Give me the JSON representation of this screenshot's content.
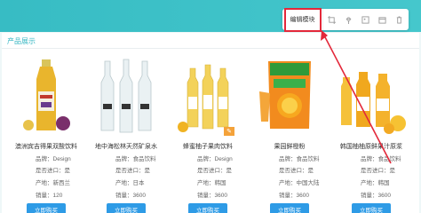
{
  "toolbar": {
    "edit_label": "编辑模块",
    "icons": [
      "crop-icon",
      "pin-icon",
      "layers-icon",
      "window-icon",
      "trash-icon"
    ],
    "highlight_color": "#e3283a"
  },
  "section": {
    "title": "产品展示"
  },
  "products": [
    {
      "name": "澳洲宾吉得果双酸饮料",
      "specs": [
        {
          "k": "品牌：",
          "v": "Design"
        },
        {
          "k": "是否进口：",
          "v": "是"
        },
        {
          "k": "产地：",
          "v": "新西兰"
        },
        {
          "k": "销量：",
          "v": "120"
        }
      ],
      "buy": "立即购买"
    },
    {
      "name": "地中海松林天然矿泉水",
      "specs": [
        {
          "k": "品牌：",
          "v": "食品饮料"
        },
        {
          "k": "是否进口：",
          "v": "是"
        },
        {
          "k": "产地：",
          "v": "日本"
        },
        {
          "k": "销量：",
          "v": "3600"
        }
      ],
      "buy": "立即购买"
    },
    {
      "name": "蜂蜜柚子果肉饮料",
      "specs": [
        {
          "k": "品牌：",
          "v": "Design"
        },
        {
          "k": "是否进口：",
          "v": "是"
        },
        {
          "k": "产地：",
          "v": "韩国"
        },
        {
          "k": "销量：",
          "v": "3600"
        }
      ],
      "buy": "立即购买"
    },
    {
      "name": "果园鲜橙粉",
      "specs": [
        {
          "k": "品牌：",
          "v": "食品饮料"
        },
        {
          "k": "是否进口：",
          "v": "是"
        },
        {
          "k": "产地：",
          "v": "中国大陆"
        },
        {
          "k": "销量：",
          "v": "3600"
        }
      ],
      "buy": "立即购买"
    },
    {
      "name": "韩国柚柚原鲜果汁原浆",
      "specs": [
        {
          "k": "品牌：",
          "v": "食品饮料"
        },
        {
          "k": "是否进口：",
          "v": "是"
        },
        {
          "k": "产地：",
          "v": "韩国"
        },
        {
          "k": "销量：",
          "v": "3600"
        }
      ],
      "buy": "立即购买"
    }
  ],
  "colors": {
    "accent": "#3bb8c4",
    "button": "#2e9be6"
  }
}
